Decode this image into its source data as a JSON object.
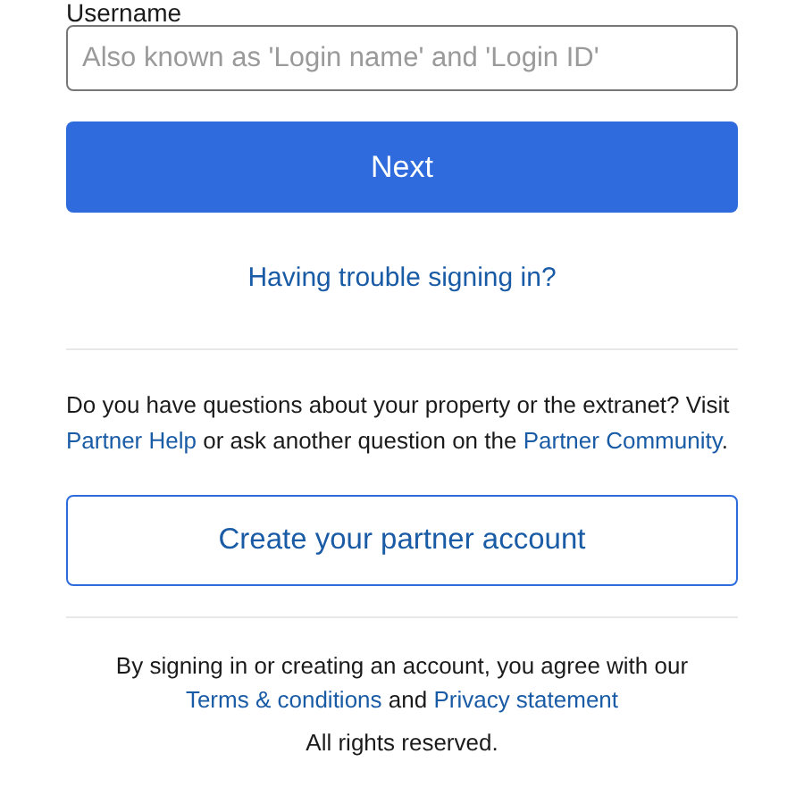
{
  "username": {
    "label": "Username",
    "placeholder": "Also known as 'Login name' and 'Login ID'"
  },
  "next_button": "Next",
  "trouble_link": "Having trouble signing in?",
  "help_text": [
    {
      "kind": "text",
      "text": "Do you have questions about your property or the extranet? Visit "
    },
    {
      "kind": "link",
      "text": "Partner Help"
    },
    {
      "kind": "text",
      "text": " or ask another question on the "
    },
    {
      "kind": "link",
      "text": "Partner Community"
    },
    {
      "kind": "text",
      "text": "."
    }
  ],
  "create_button": "Create your partner account",
  "terms_text": [
    {
      "kind": "text",
      "text": "By signing in or creating an account, you agree with our "
    },
    {
      "kind": "link",
      "text": "Terms & conditions"
    },
    {
      "kind": "text",
      "text": " and "
    },
    {
      "kind": "link",
      "text": "Privacy statement"
    }
  ],
  "rights": "All rights reserved."
}
